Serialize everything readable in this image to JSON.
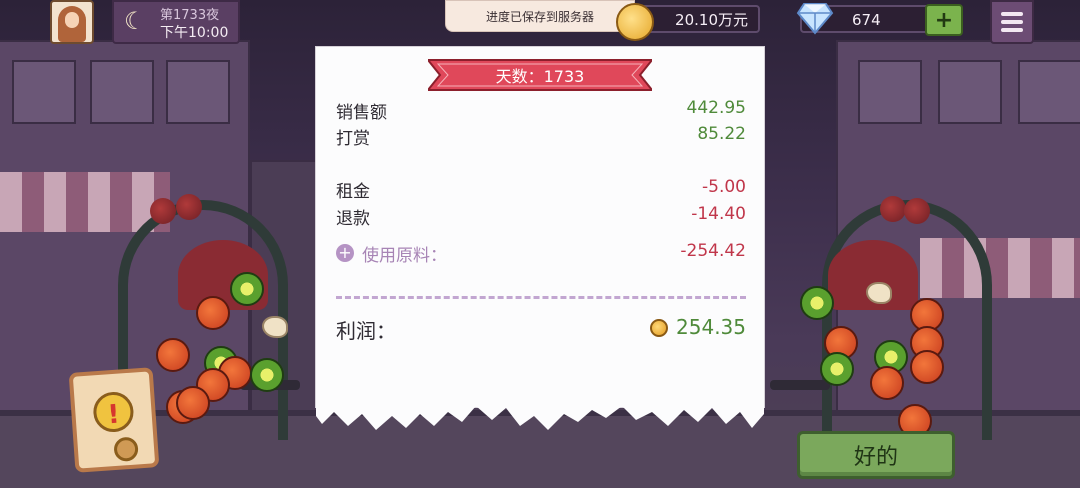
{
  "hud": {
    "night_label": "第1733夜",
    "time_label": "下午10:00",
    "toast": "进度已保存到服务器",
    "money": "20.10万元",
    "gems": "674",
    "add_label": "+"
  },
  "receipt": {
    "title": "天数：1733",
    "rows": [
      {
        "label": "销售额",
        "value": "442.95"
      },
      {
        "label": "打赏",
        "value": "85.22"
      },
      {
        "label": "租金",
        "value": "-5.00"
      },
      {
        "label": "退款",
        "value": "-14.40"
      },
      {
        "label": "使用原料：",
        "value": "-254.42"
      }
    ],
    "profit_label": "利润：",
    "profit_value": "254.35"
  },
  "ok_button": "好的",
  "colors": {
    "positive": "#4f8a3a",
    "negative": "#c0364a",
    "banner": "#e0485a",
    "ok_button": "#7ba85c"
  }
}
